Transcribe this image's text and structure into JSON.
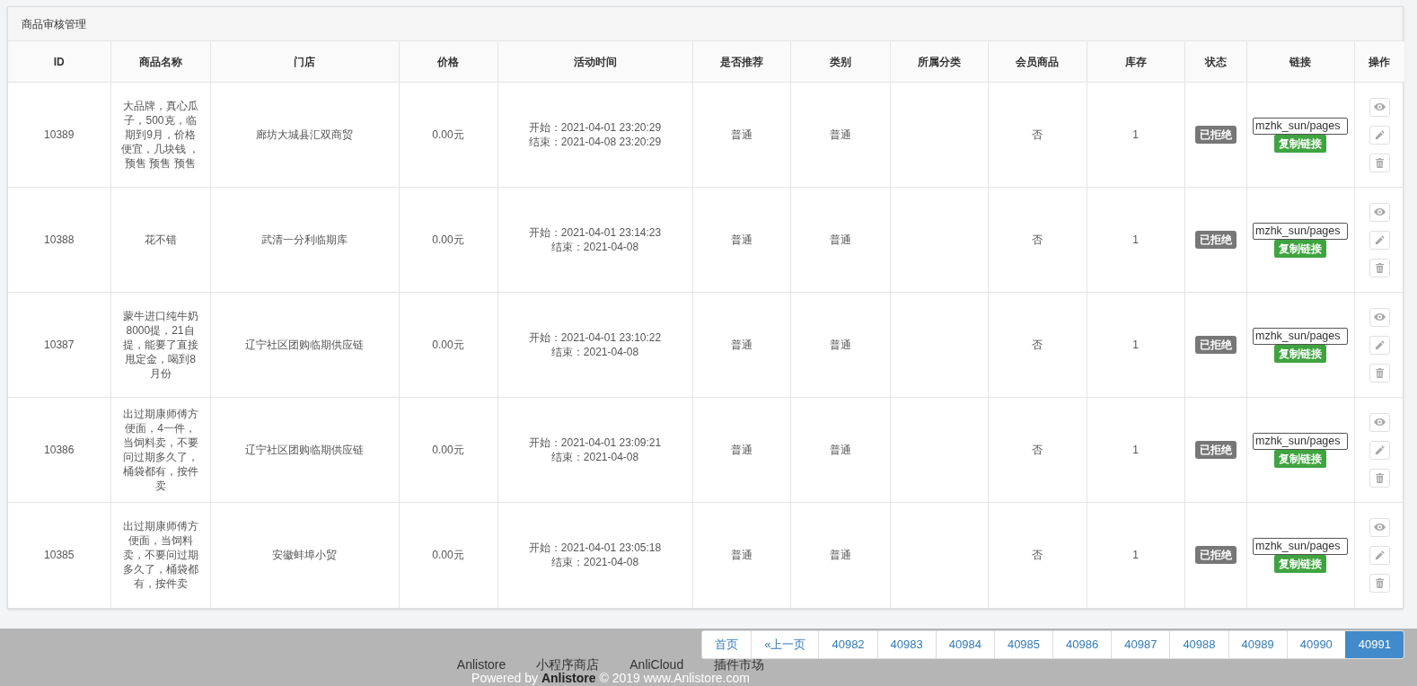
{
  "panel": {
    "title": "商品审核管理"
  },
  "table": {
    "columns": [
      "ID",
      "商品名称",
      "门店",
      "价格",
      "活动时间",
      "是否推荐",
      "类别",
      "所属分类",
      "会员商品",
      "库存",
      "状态",
      "链接",
      "操作"
    ],
    "rows": [
      {
        "id": "10389",
        "name": "大品牌，真心瓜子，500克，临期到9月，价格便宜，几块钱 ，预售 预售 预售",
        "store": "廊坊大城县汇双商贸",
        "price": "0.00元",
        "start": "开始：2021-04-01 23:20:29",
        "end": "结束：2021-04-08 23:20:29",
        "recommended": "普通",
        "type": "普通",
        "member": "否",
        "stock": "1",
        "status": "已拒绝",
        "link": "mzhk_sun/pages",
        "copy": "复制链接"
      },
      {
        "id": "10388",
        "name": "花不错",
        "store": "武清一分利临期库",
        "price": "0.00元",
        "start": "开始：2021-04-01 23:14:23",
        "end": "结束：2021-04-08",
        "recommended": "普通",
        "type": "普通",
        "member": "否",
        "stock": "1",
        "status": "已拒绝",
        "link": "mzhk_sun/pages",
        "copy": "复制链接"
      },
      {
        "id": "10387",
        "name": "蒙牛进口纯牛奶8000提，21自提，能要了直接甩定金，喝到8月份",
        "store": "辽宁社区团购临期供应链",
        "price": "0.00元",
        "start": "开始：2021-04-01 23:10:22",
        "end": "结束：2021-04-08",
        "recommended": "普通",
        "type": "普通",
        "member": "否",
        "stock": "1",
        "status": "已拒绝",
        "link": "mzhk_sun/pages",
        "copy": "复制链接"
      },
      {
        "id": "10386",
        "name": "出过期康师傅方便面，4一件，当饲料卖，不要问过期多久了，桶袋都有，按件卖",
        "store": "辽宁社区团购临期供应链",
        "price": "0.00元",
        "start": "开始：2021-04-01 23:09:21",
        "end": "结束：2021-04-08",
        "recommended": "普通",
        "type": "普通",
        "member": "否",
        "stock": "1",
        "status": "已拒绝",
        "link": "mzhk_sun/pages",
        "copy": "复制链接"
      },
      {
        "id": "10385",
        "name": "出过期康师傅方便面，当饲料卖，不要问过期多久了，桶袋都有，按件卖",
        "store": "安徽蚌埠小贸",
        "price": "0.00元",
        "start": "开始：2021-04-01 23:05:18",
        "end": "结束：2021-04-08",
        "recommended": "普通",
        "type": "普通",
        "member": "否",
        "stock": "1",
        "status": "已拒绝",
        "link": "mzhk_sun/pages",
        "copy": "复制链接"
      }
    ]
  },
  "pagination": {
    "items": [
      {
        "label": "首页",
        "selected": false
      },
      {
        "label": "«上一页",
        "selected": false
      },
      {
        "label": "40982",
        "selected": false
      },
      {
        "label": "40983",
        "selected": false
      },
      {
        "label": "40984",
        "selected": false
      },
      {
        "label": "40985",
        "selected": false
      },
      {
        "label": "40986",
        "selected": false
      },
      {
        "label": "40987",
        "selected": false
      },
      {
        "label": "40988",
        "selected": false
      },
      {
        "label": "40989",
        "selected": false
      },
      {
        "label": "40990",
        "selected": false
      },
      {
        "label": "40991",
        "selected": true
      }
    ]
  },
  "footer": {
    "links": [
      "Anlistore",
      "小程序商店",
      "AnliCloud",
      "插件市场"
    ],
    "powered": "Powered by **Anlistore** © 2019 www.Anlistore.com"
  }
}
